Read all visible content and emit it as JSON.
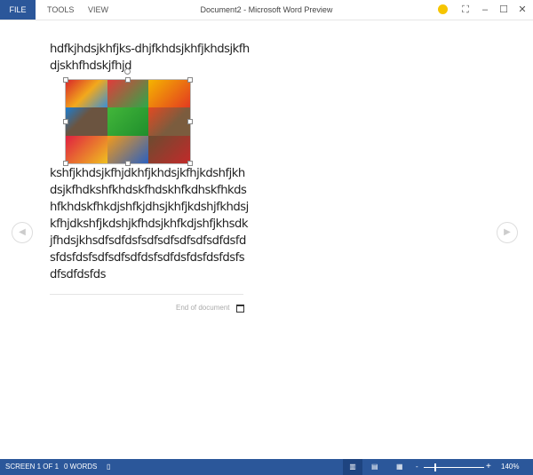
{
  "titlebar": {
    "tabs": [
      "FILE",
      "TOOLS",
      "VIEW"
    ],
    "title": "Document2 - Microsoft Word Preview"
  },
  "document": {
    "para1": "hdfkjhdsjkhfjks-dhjfkhdsjkhfjkhdsjkfhdjskhfhdskjfhjd",
    "para2": "kshfjkhdsjkfhjdkhfjkhdsjkfhjkdshfjkhdsjkfhdkshfkhdskfhdskhfkdhskfhkdshfkhdskfhkdjshfkjdhsjkhfjkdshjfkhdsjkfhjdkshfjkdshjkfhdsjkhfkdjshfjkhsdkjfhdsjkhsdfsdfdsfsdfsdfsdfsdfsdfdsfdsfdsfdsfsdfsdfsdfdsfsdfdsfdsfdsfdsfsdfsdfdsfds",
    "end_label": "End of document"
  },
  "status": {
    "screen": "SCREEN 1 OF 1",
    "words": "0 WORDS",
    "zoom": "140%",
    "zoom_minus": "-",
    "zoom_plus": "+"
  },
  "colors": {
    "accent": "#2b579a"
  }
}
